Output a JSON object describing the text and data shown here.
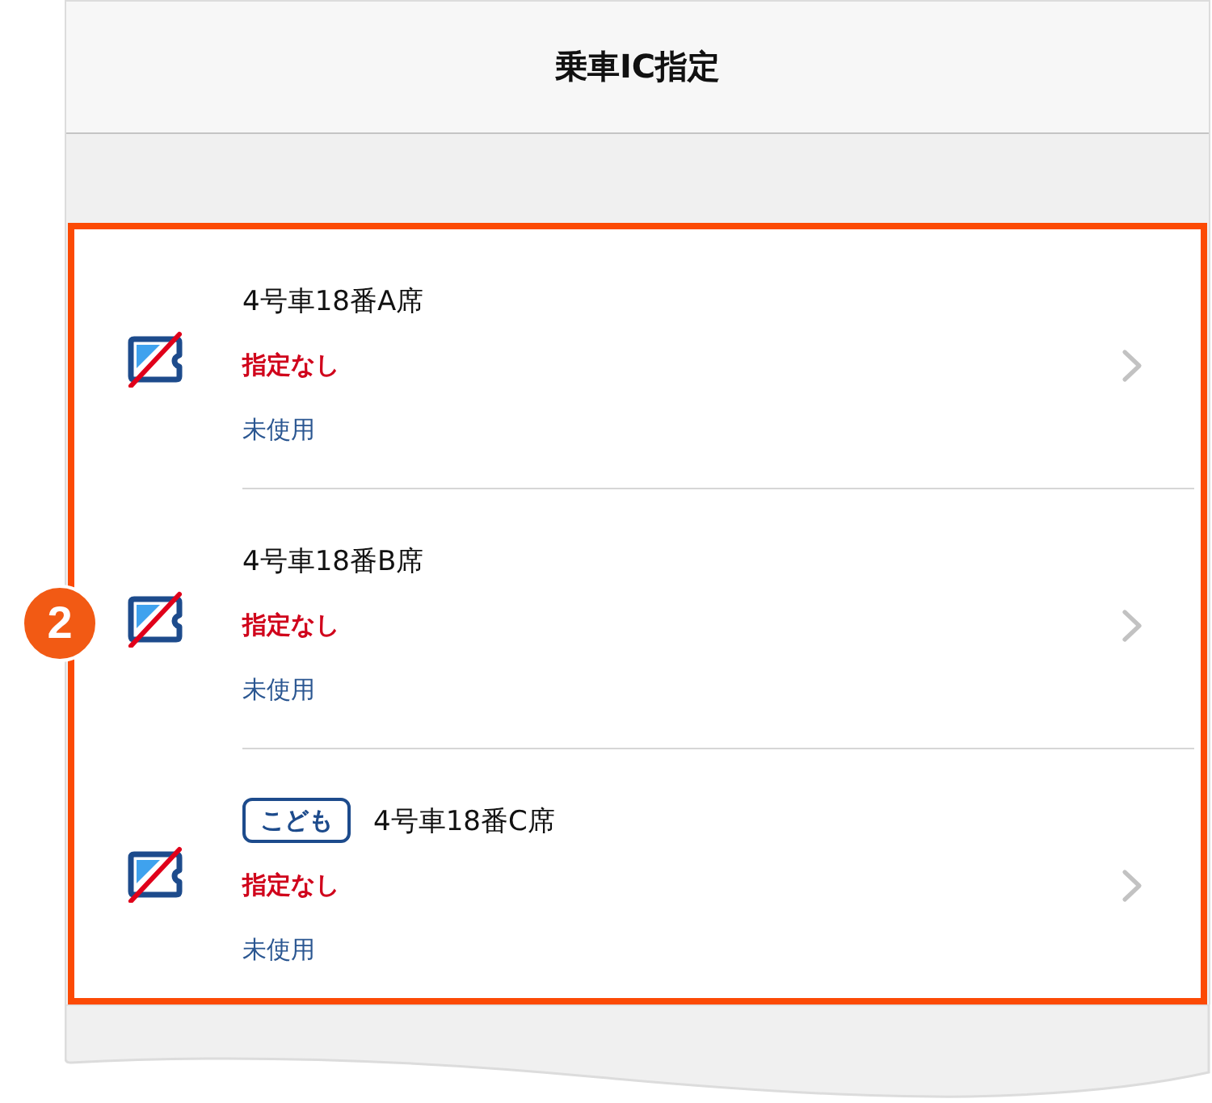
{
  "header": {
    "title": "乗車IC指定"
  },
  "callout": {
    "label": "2"
  },
  "seats": [
    {
      "seat": "4号車18番A席",
      "status": "指定なし",
      "usage": "未使用"
    },
    {
      "seat": "4号車18番B席",
      "status": "指定なし",
      "usage": "未使用"
    },
    {
      "badge": "こども",
      "seat": "4号車18番C席",
      "status": "指定なし",
      "usage": "未使用"
    }
  ]
}
